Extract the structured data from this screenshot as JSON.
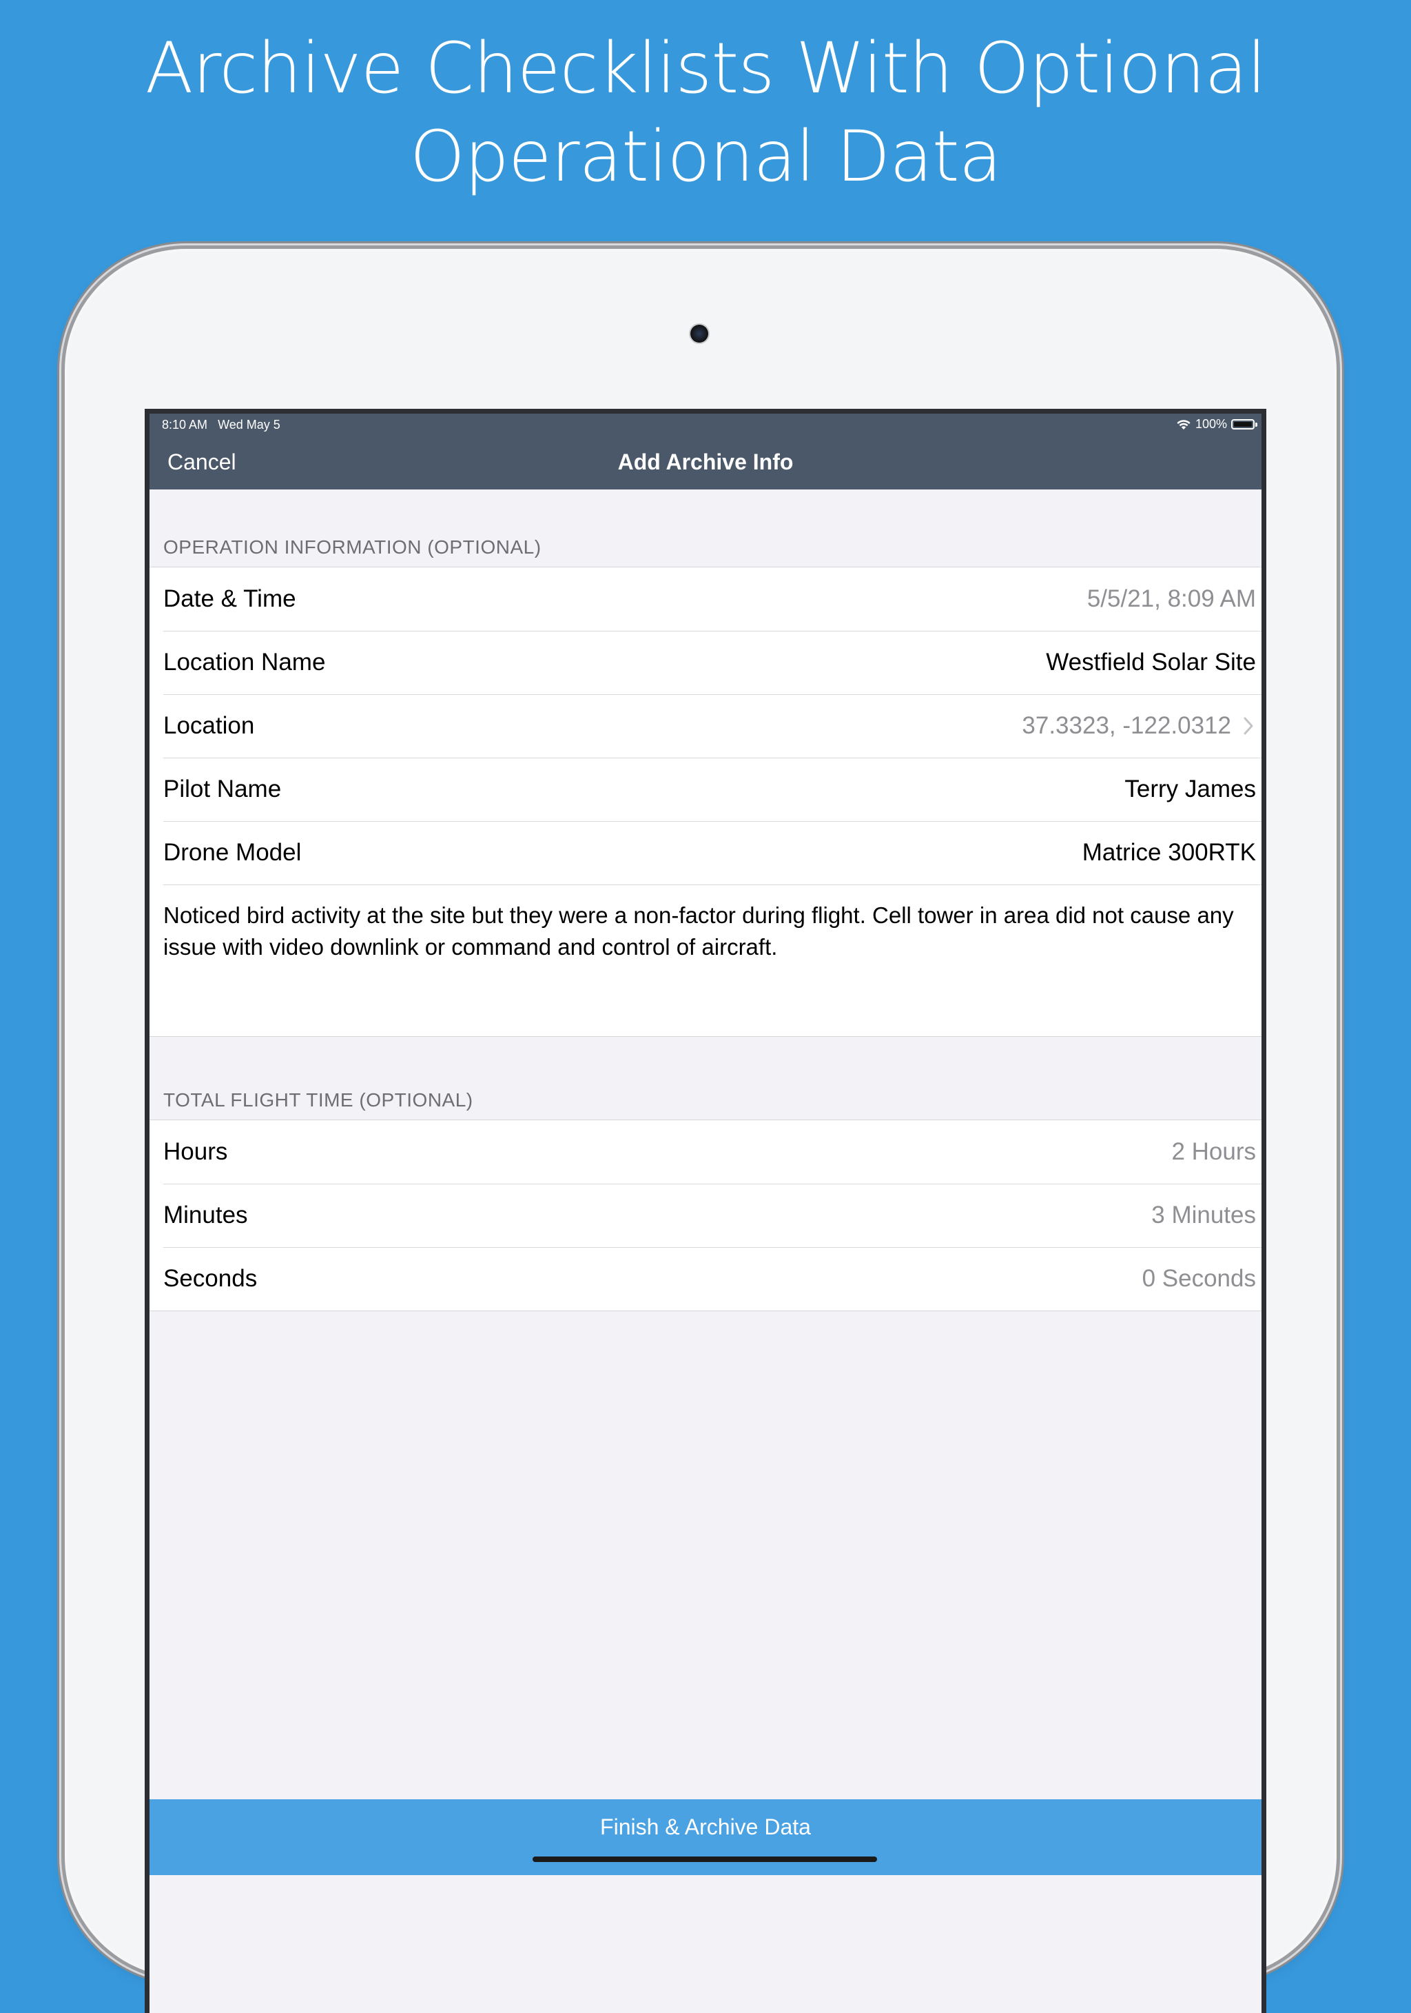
{
  "headline": "Archive Checklists With Optional Operational Data",
  "status_bar": {
    "time": "8:10 AM",
    "date": "Wed May 5",
    "battery": "100%"
  },
  "nav": {
    "cancel_label": "Cancel",
    "title": "Add Archive Info"
  },
  "operation_section": {
    "header": "OPERATION INFORMATION (OPTIONAL)",
    "rows": [
      {
        "label": "Date & Time",
        "value": "5/5/21, 8:09 AM"
      },
      {
        "label": "Location Name",
        "value": "Westfield Solar Site"
      },
      {
        "label": "Location",
        "value": "37.3323, -122.0312"
      },
      {
        "label": "Pilot Name",
        "value": "Terry James"
      },
      {
        "label": "Drone Model",
        "value": "Matrice 300RTK"
      }
    ],
    "notes": "Noticed bird activity at the site but they were a non-factor during flight. Cell tower in area did not cause any issue with video downlink or command and control of aircraft."
  },
  "flight_time_section": {
    "header": "TOTAL FLIGHT TIME (OPTIONAL)",
    "rows": [
      {
        "label": "Hours",
        "value": "2 Hours"
      },
      {
        "label": "Minutes",
        "value": "3 Minutes"
      },
      {
        "label": "Seconds",
        "value": "0 Seconds"
      }
    ]
  },
  "finish_button_label": "Finish & Archive Data",
  "colors": {
    "background": "#3798dc",
    "nav_bar": "#4a5869",
    "finish_button": "#4aa2e3"
  }
}
